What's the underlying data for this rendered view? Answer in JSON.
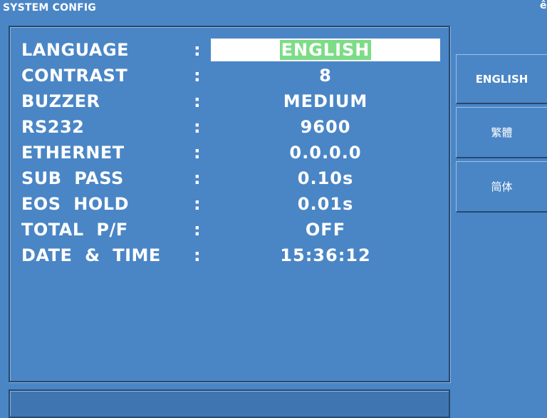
{
  "window": {
    "title": "SYSTEM CONFIG",
    "corner_glyph": "ê"
  },
  "settings": [
    {
      "label": "LANGUAGE",
      "value": "ENGLISH",
      "selected": true
    },
    {
      "label": "CONTRAST",
      "value": "8"
    },
    {
      "label": "BUZZER",
      "value": "MEDIUM"
    },
    {
      "label": "RS232",
      "value": "9600"
    },
    {
      "label": "ETHERNET",
      "value": "0.0.0.0"
    },
    {
      "label": "SUB  PASS",
      "value": "0.10s"
    },
    {
      "label": "EOS  HOLD",
      "value": "0.01s"
    },
    {
      "label": "TOTAL  P/F",
      "value": "OFF"
    },
    {
      "label": "DATE  &  TIME",
      "value": "15:36:12"
    }
  ],
  "separator": ":",
  "softkeys": [
    {
      "label": "ENGLISH"
    },
    {
      "label": "繁體"
    },
    {
      "label": "简体"
    }
  ],
  "colors": {
    "background": "#4a86c6",
    "highlight": "#7ddc86",
    "field_bg": "#ffffff",
    "border_dark": "#25496f"
  }
}
